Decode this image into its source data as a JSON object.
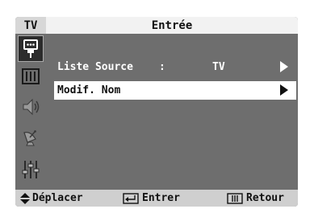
{
  "header": {
    "tab": "TV",
    "title": "Entrée"
  },
  "sidebar": {
    "items": [
      {
        "name": "input-icon",
        "active": true
      },
      {
        "name": "picture-icon",
        "active": false
      },
      {
        "name": "sound-icon",
        "active": false
      },
      {
        "name": "channel-icon",
        "active": false
      },
      {
        "name": "setup-icon",
        "active": false
      }
    ]
  },
  "menu": {
    "items": [
      {
        "label": "Liste Source",
        "separator": ":",
        "value": "TV",
        "selected": false
      },
      {
        "label": "Modif. Nom",
        "separator": "",
        "value": "",
        "selected": true
      }
    ]
  },
  "footer": {
    "move_label": "Déplacer",
    "enter_label": "Entrer",
    "return_label": "Retour"
  },
  "colors": {
    "panel": "#6e6e6e",
    "header_bg": "#f2f2f2",
    "selected_bg": "#ffffff",
    "footer_bg": "#cfcfcf"
  }
}
